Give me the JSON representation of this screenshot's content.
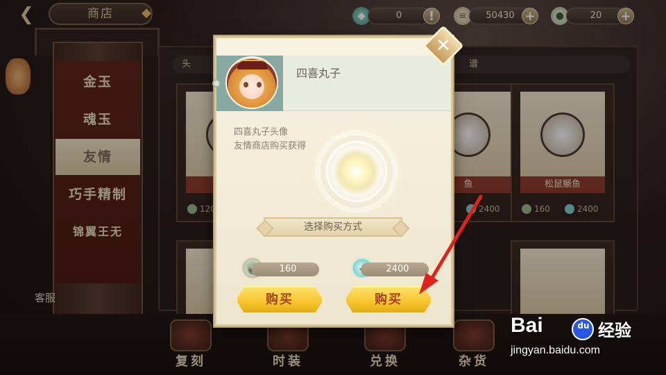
{
  "topbar": {
    "title": "商店",
    "currencies": [
      {
        "icon": "jade-token-icon",
        "value": "0"
      },
      {
        "icon": "scroll-icon",
        "value": "50430"
      },
      {
        "icon": "coin-icon",
        "value": "20"
      }
    ]
  },
  "side_menu": {
    "items": [
      {
        "label": "金玉"
      },
      {
        "label": "魂玉"
      },
      {
        "label": "友情"
      },
      {
        "label": "巧手精制"
      },
      {
        "label": "锦翼王无"
      }
    ],
    "active_index": 2,
    "kefu": "客服"
  },
  "shop": {
    "tabs": [
      "头",
      "谱"
    ],
    "cards": [
      {
        "name": "醒",
        "price_coin": "120",
        "price_gem": ""
      },
      {
        "name": "鱼",
        "price_coin": "",
        "price_gem": "2400"
      },
      {
        "name": "松鼠鳜鱼",
        "price_coin": "160",
        "price_gem": "2400"
      }
    ]
  },
  "bottom_nav": [
    {
      "label": "复刻",
      "icon": "bundle-icon"
    },
    {
      "label": "时装",
      "icon": "fan-icon"
    },
    {
      "label": "兑换",
      "icon": "drum-icon"
    },
    {
      "label": "杂货",
      "icon": "bowl-icon"
    }
  ],
  "dialog": {
    "item_name": "四喜丸子",
    "desc_line1": "四喜丸子头像",
    "desc_line2": "友情商店购买获得",
    "choose_label": "选择购买方式",
    "options": [
      {
        "currency_icon": "friendship-coin-icon",
        "price": "160",
        "buy_label": "购买"
      },
      {
        "currency_icon": "handshake-gem-icon",
        "price": "2400",
        "buy_label": "购买"
      }
    ],
    "close_glyph": "✕"
  },
  "watermark": {
    "brand": "Bai",
    "du": "du",
    "jingyan": "经验",
    "url": "jingyan.baidu.com"
  },
  "colors": {
    "arrow": "#e0221c",
    "buy_button": "#f6c52b",
    "dialog_bg": "#f7f2e2"
  }
}
